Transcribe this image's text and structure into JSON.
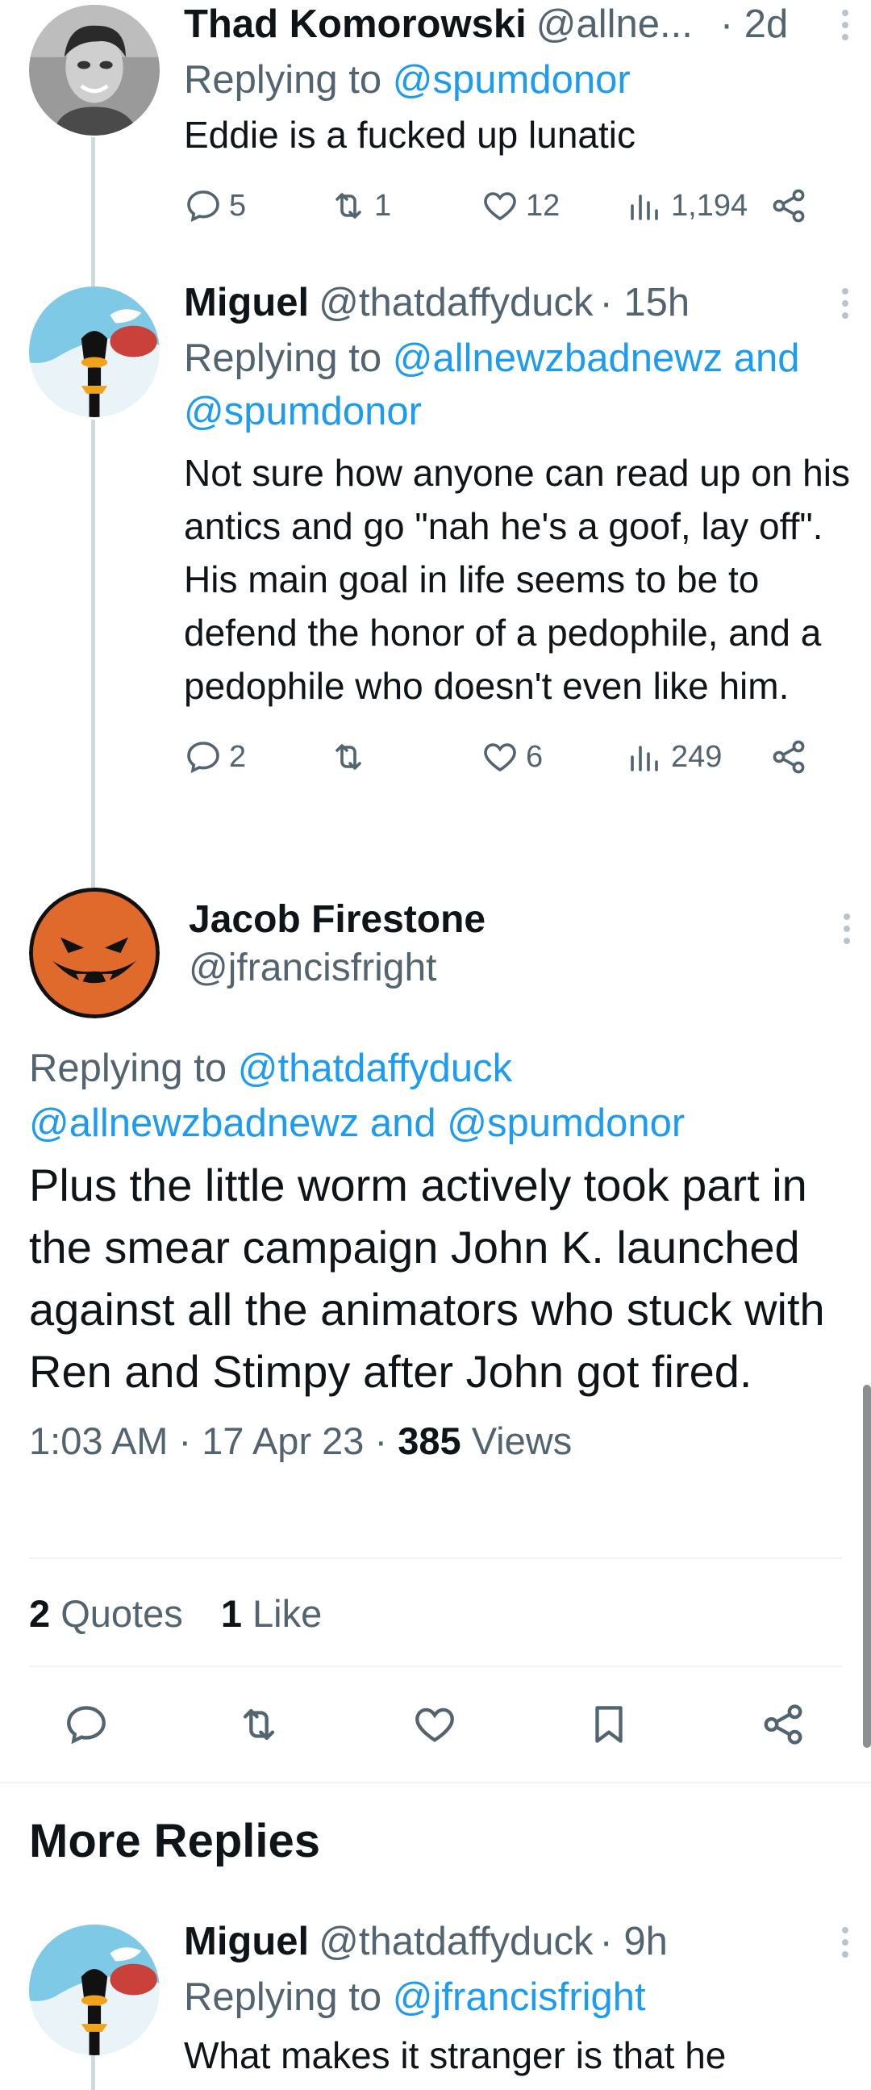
{
  "replies_above": [
    {
      "name": "Thad Komorowski",
      "handle": "@allne...",
      "time": "· 2d",
      "replying_label": "Replying to",
      "replying_to": "@spumdonor",
      "text": "Eddie is a fucked up lunatic",
      "comments": "5",
      "retweets": "1",
      "likes": "12",
      "views": "1,194"
    },
    {
      "name": "Miguel",
      "handle": "@thatdaffyduck",
      "time": "· 15h",
      "replying_label": "Replying to",
      "replying_to": "@allnewzbadnewz and @spumdonor",
      "text": "Not sure how anyone can read up on his antics and go \"nah he's a goof, lay off\". His main goal in life seems to be to defend the honor of a pedophile, and a pedophile who doesn't even like him.",
      "comments": "2",
      "retweets": "",
      "likes": "6",
      "views": "249"
    }
  ],
  "main_tweet": {
    "name": "Jacob Firestone",
    "handle": "@jfrancisfright",
    "replying_label": "Replying to",
    "replying_to": "@thatdaffyduck @allnewzbadnewz and @spumdonor",
    "text": "Plus the little worm actively took part in the smear campaign John K. launched against all the animators who stuck with Ren and Stimpy after John got fired.",
    "timestamp": "1:03 AM · 17 Apr 23 · ",
    "views_count": "385",
    "views_label": "Views",
    "quotes_count": "2",
    "quotes_label": "Quotes",
    "likes_count": "1",
    "likes_label": "Like"
  },
  "more_replies": {
    "title": "More Replies",
    "first": {
      "name": "Miguel",
      "handle": "@thatdaffyduck",
      "time": "· 9h",
      "replying_label": "Replying to",
      "replying_to": "@jfrancisfright",
      "text": "What makes it stranger is that he"
    }
  },
  "colors": {
    "link": "#1d9bf0",
    "secondary_text": "#536471",
    "primary_text": "#0f1419",
    "thread_line": "#cfd9de"
  },
  "icons": [
    "reply-icon",
    "retweet-icon",
    "like-icon",
    "views-icon",
    "share-icon",
    "bookmark-icon",
    "more-icon"
  ]
}
